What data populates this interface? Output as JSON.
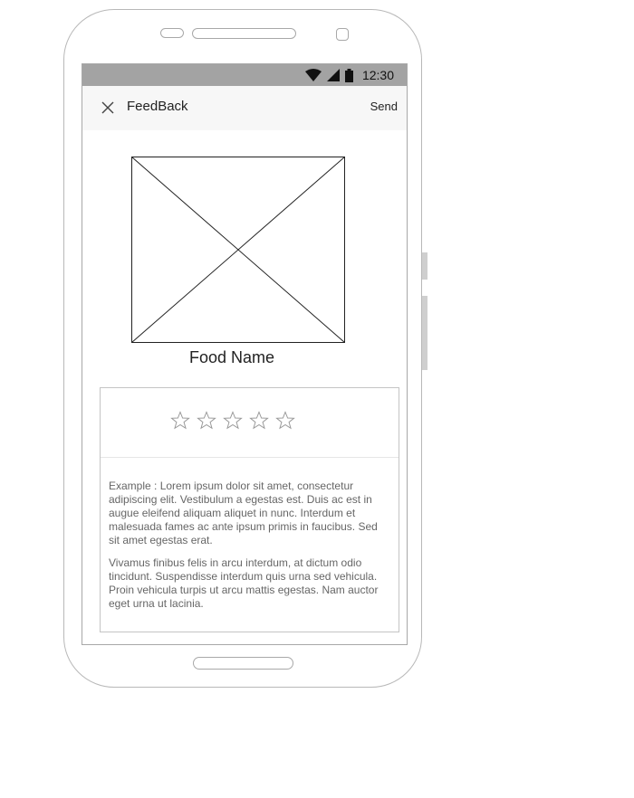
{
  "statusbar": {
    "time": "12:30",
    "icons": [
      "wifi-icon",
      "signal-icon",
      "battery-icon"
    ]
  },
  "appbar": {
    "close_icon": "close-icon",
    "title": "FeedBack",
    "send_label": "Send"
  },
  "product": {
    "image_icon": "image-placeholder-icon",
    "name": "Food Name"
  },
  "rating": {
    "max": 5,
    "value": 0
  },
  "feedback": {
    "paragraphs": [
      "Example : Lorem ipsum dolor sit amet, consectetur adipiscing elit. Vestibulum a egestas est. Duis ac est in augue eleifend aliquam aliquet in nunc. Interdum et malesuada fames ac ante ipsum primis in faucibus. Sed sit amet egestas erat.",
      "Vivamus finibus felis in arcu interdum, at dictum odio tincidunt. Suspendisse interdum quis urna sed vehicula. Proin vehicula turpis ut arcu mattis egestas. Nam auctor eget urna ut lacinia."
    ]
  },
  "colors": {
    "statusbar": "#a3a3a3",
    "appbar": "#f7f7f7",
    "outline": "#a8a8a8",
    "star_outline": "#9a9a9a"
  }
}
